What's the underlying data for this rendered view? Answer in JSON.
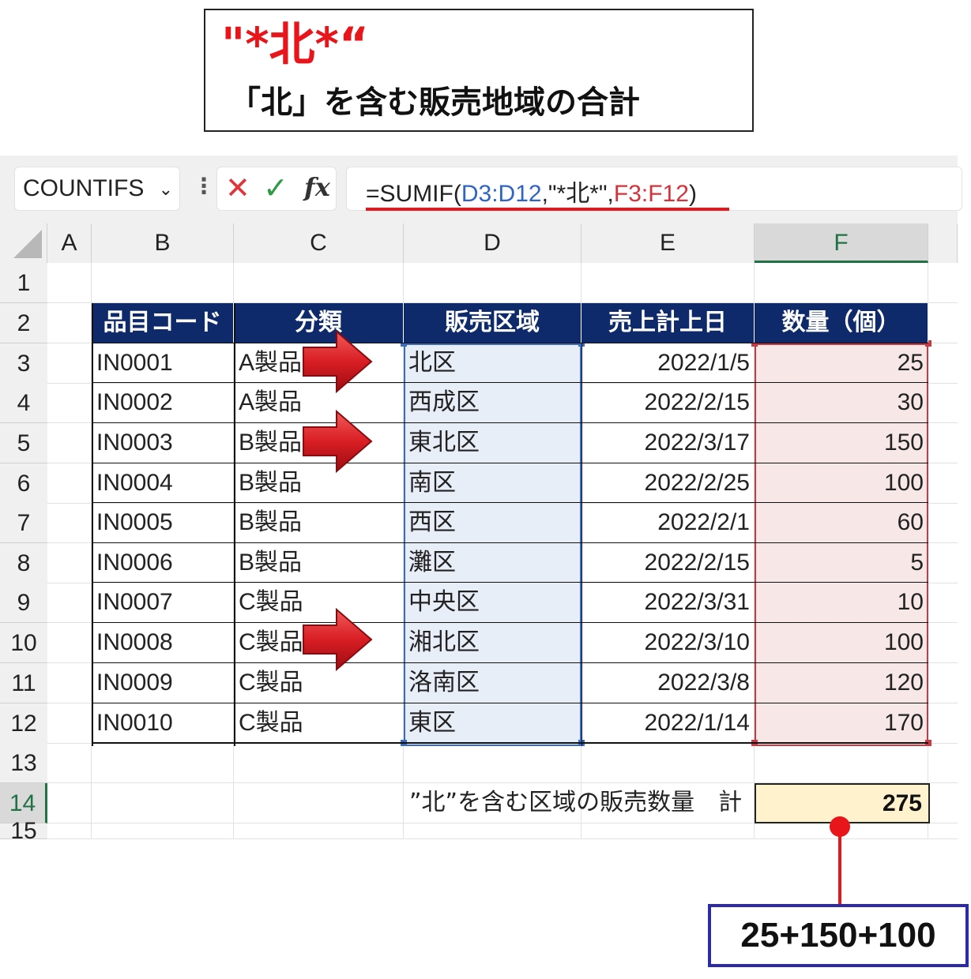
{
  "callout": {
    "pattern": "\"*北*“",
    "description": "「北」を含む販売地域の合計"
  },
  "formula_bar": {
    "name_box": "COUNTIFS",
    "cancel_icon": "close-icon",
    "enter_icon": "check-icon",
    "fx_label": "fx",
    "formula_prefix": "=SUMIF(",
    "formula_range1": "D3:D12",
    "formula_criteria": ",\"*北*\",",
    "formula_range2": "F3:F12",
    "formula_suffix": ")"
  },
  "columns": [
    "A",
    "B",
    "C",
    "D",
    "E",
    "F"
  ],
  "rows": [
    "1",
    "2",
    "3",
    "4",
    "5",
    "6",
    "7",
    "8",
    "9",
    "10",
    "11",
    "12",
    "13",
    "14",
    "15"
  ],
  "table": {
    "headers": [
      "品目コード",
      "分類",
      "販売区域",
      "売上計上日",
      "数量（個）"
    ],
    "data": [
      [
        "IN0001",
        "A製品",
        "北区",
        "2022/1/5",
        "25"
      ],
      [
        "IN0002",
        "A製品",
        "西成区",
        "2022/2/15",
        "30"
      ],
      [
        "IN0003",
        "B製品",
        "東北区",
        "2022/3/17",
        "150"
      ],
      [
        "IN0004",
        "B製品",
        "南区",
        "2022/2/25",
        "100"
      ],
      [
        "IN0005",
        "B製品",
        "西区",
        "2022/2/1",
        "60"
      ],
      [
        "IN0006",
        "B製品",
        "灘区",
        "2022/2/15",
        "5"
      ],
      [
        "IN0007",
        "C製品",
        "中央区",
        "2022/3/31",
        "10"
      ],
      [
        "IN0008",
        "C製品",
        "湘北区",
        "2022/3/10",
        "100"
      ],
      [
        "IN0009",
        "C製品",
        "洛南区",
        "2022/3/8",
        "120"
      ],
      [
        "IN0010",
        "C製品",
        "東区",
        "2022/1/14",
        "170"
      ]
    ]
  },
  "total": {
    "label": "”北”を含む区域の販売数量　計",
    "value": "275"
  },
  "result": "25+150+100",
  "colors": {
    "header_bg": "#0e2a6b",
    "d_range": "#3a6cc4",
    "f_range": "#c73a44",
    "accent_red": "#e8151b",
    "result_border": "#2c2aa6",
    "total_bg": "#fff2cc"
  }
}
